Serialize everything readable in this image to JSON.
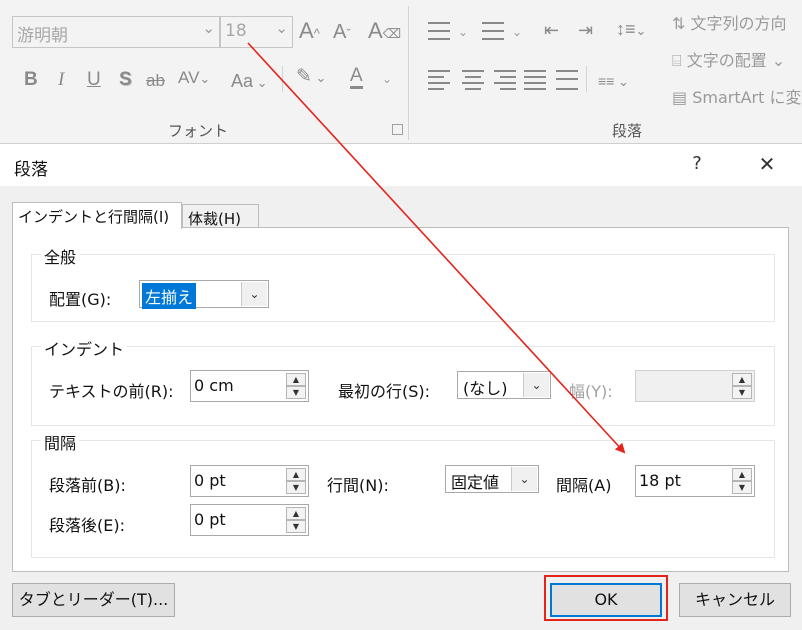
{
  "ribbon": {
    "font_name": "游明朝",
    "font_size": "18",
    "grow_font": "A",
    "shrink_font": "A",
    "bold": "B",
    "italic": "I",
    "underline": "U",
    "shadow": "S",
    "strike": "ab",
    "spacing": "AV",
    "case": "Aa",
    "font_color": "A",
    "group_font": "フォント",
    "group_paragraph": "段落",
    "text_direction": "文字列の方向",
    "align_text": "文字の配置",
    "smartart": "SmartArt に変"
  },
  "dialog": {
    "title": "段落",
    "help": "?",
    "close": "✕",
    "tabs": [
      "インデントと行間隔(I)",
      "体裁(H)"
    ],
    "general": {
      "title": "全般",
      "alignment_label": "配置(G):",
      "alignment_value": "左揃え"
    },
    "indent": {
      "title": "インデント",
      "before_text_label": "テキストの前(R):",
      "before_text_value": "0 cm",
      "first_line_label": "最初の行(S):",
      "first_line_value": "(なし)",
      "by_label": "幅(Y):",
      "by_value": ""
    },
    "spacing": {
      "title": "間隔",
      "before_label": "段落前(B):",
      "before_value": "0 pt",
      "after_label": "段落後(E):",
      "after_value": "0 pt",
      "line_spacing_label": "行間(N):",
      "line_spacing_value": "固定値",
      "at_label": "間隔(A)",
      "at_value": "18 pt"
    },
    "buttons": {
      "tabs_leaders": "タブとリーダー(T)...",
      "ok": "OK",
      "cancel": "キャンセル"
    }
  },
  "colors": {
    "annotation": "#e3241b",
    "selection": "#0078d7"
  }
}
